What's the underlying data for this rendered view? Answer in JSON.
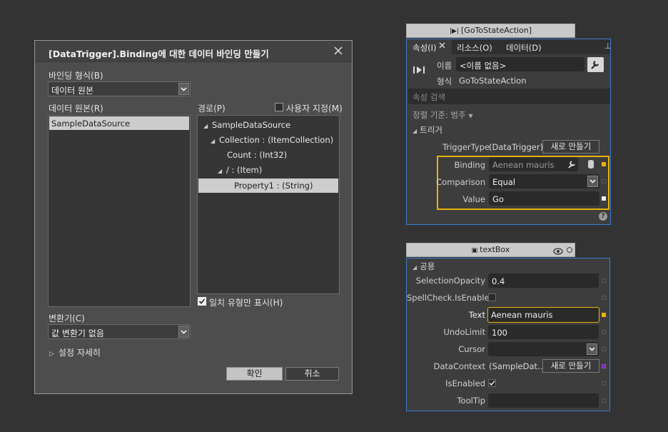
{
  "dialog": {
    "title": "[DataTrigger].Binding에 대한 데이터 바인딩 만들기",
    "binding_type_label": "바인딩 형식(B)",
    "binding_type_value": "데이터 원본",
    "data_source_label": "데이터 원본(R)",
    "data_sources": [
      "SampleDataSource"
    ],
    "path_label": "경로(P)",
    "custom_label": "사용자 지정(M)",
    "custom_checked": false,
    "tree": [
      {
        "text": "SampleDataSource",
        "expanded": true
      },
      {
        "text": "Collection : (ItemCollection)",
        "expanded": true
      },
      {
        "text": "Count : (Int32)"
      },
      {
        "text": "/ : (Item)",
        "expanded": true
      },
      {
        "text": "Property1 : (String)",
        "selected": true
      }
    ],
    "match_type_label": "일치 유형만 표시(H)",
    "match_type_checked": true,
    "converter_label": "변환기(C)",
    "converter_value": "값 변환기 없음",
    "details_label": "설정 자세히",
    "ok_label": "확인",
    "cancel_label": "취소"
  },
  "props_panel": {
    "tab_title": "[GoToStateAction]",
    "tabs": [
      "속성(I)",
      "리소스(O)",
      "데이터(D)"
    ],
    "name_label": "이름",
    "name_value": "<이름 없음>",
    "type_label": "형식",
    "type_value": "GoToStateAction",
    "search_placeholder": "속성 검색",
    "sort_label": "정렬 기준: 범주",
    "section_trigger": "트리거",
    "trigger_type_label": "TriggerType",
    "trigger_type_value": "(DataTrigger)",
    "new_label": "새로 만들기",
    "binding_label": "Binding",
    "binding_value": "Aenean mauris",
    "comparison_label": "Comparison",
    "comparison_value": "Equal",
    "value_label": "Value",
    "value_value": "Go",
    "help_glyph": "?"
  },
  "textbox_panel": {
    "tab_title": "textBox",
    "section_common": "공용",
    "rows": {
      "selection_opacity": {
        "label": "SelectionOpacity",
        "value": "0.4"
      },
      "spellcheck": {
        "label": "SpellCheck.IsEnabled",
        "checked": false
      },
      "text": {
        "label": "Text",
        "value": "Aenean mauris"
      },
      "undo_limit": {
        "label": "UndoLimit",
        "value": "100"
      },
      "cursor": {
        "label": "Cursor",
        "value": ""
      },
      "data_context": {
        "label": "DataContext",
        "value": "(SampleDat…",
        "button": "새로 만들기"
      },
      "is_enabled": {
        "label": "IsEnabled",
        "checked": true
      },
      "tooltip": {
        "label": "ToolTip",
        "value": ""
      }
    }
  },
  "colors": {
    "accent_blue": "#3d7bd0",
    "highlight_yellow": "#e8b20e",
    "background": "#333333"
  }
}
